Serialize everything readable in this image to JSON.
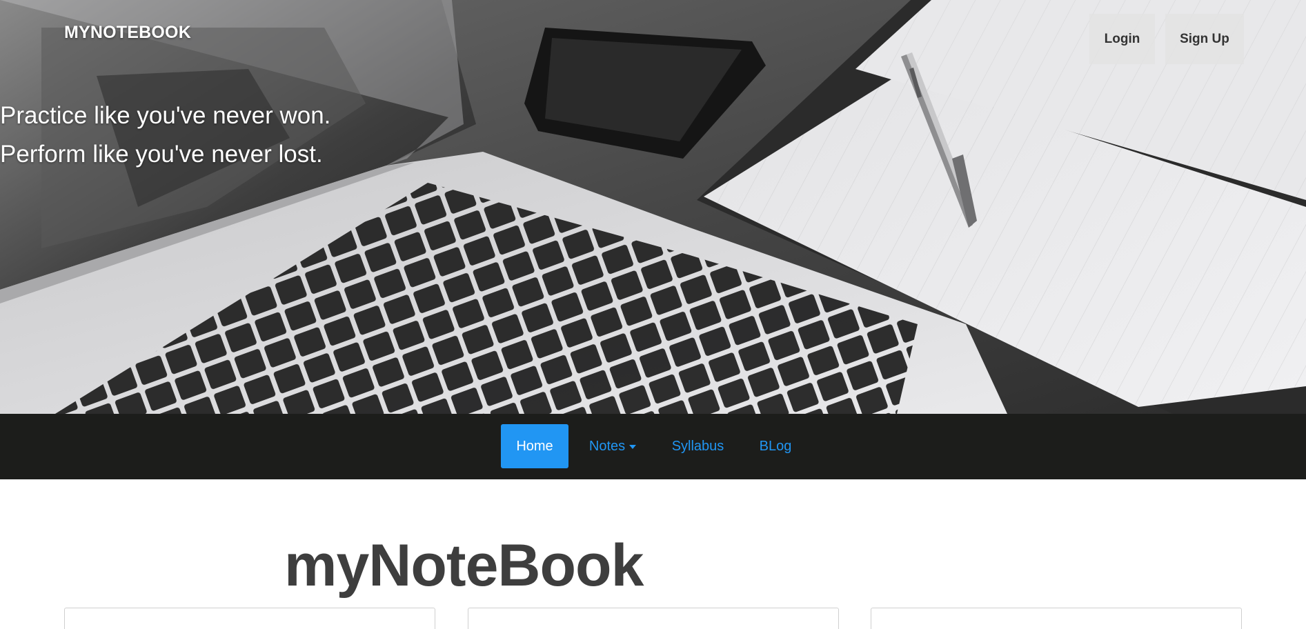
{
  "header": {
    "brand": "MYNOTEBOOK",
    "tagline_line1": "Practice like you've never won.",
    "tagline_line2": "Perform like you've never lost.",
    "login_label": "Login",
    "signup_label": "Sign Up"
  },
  "nav": {
    "items": [
      {
        "label": "Home",
        "active": true
      },
      {
        "label": "Notes",
        "has_dropdown": true,
        "icon": "caret-down-icon"
      },
      {
        "label": "Syllabus"
      },
      {
        "label": "BLog"
      }
    ]
  },
  "main": {
    "title": "myNoteBook",
    "cards_count": 3
  },
  "colors": {
    "accent": "#2196f3",
    "nav_background": "#1c1d1b",
    "title_text": "#3e3e3e",
    "auth_button_bg": "#e2e2e2"
  }
}
